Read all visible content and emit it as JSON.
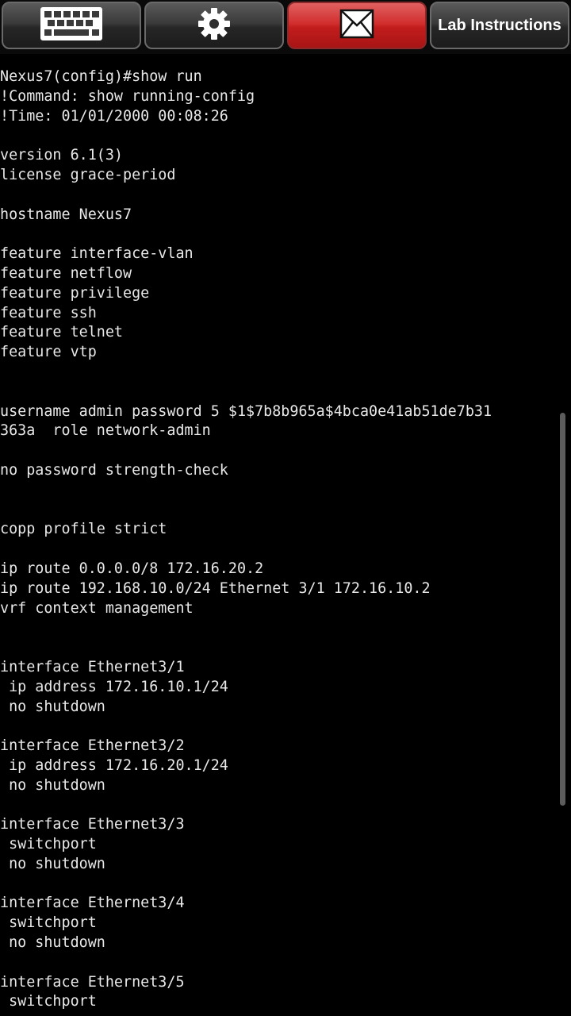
{
  "toolbar": {
    "keyboard_icon": "keyboard-icon",
    "settings_icon": "gear-icon",
    "mail_icon": "envelope-icon",
    "lab_instructions_label": "Lab Instructions",
    "colors": {
      "button_gray": "#3a3a3a",
      "button_red": "#d22f2f",
      "text": "#ffffff"
    }
  },
  "terminal": {
    "background": "#000000",
    "text_color": "#e8e8e8",
    "lines": [
      "Nexus7(config)#show run",
      "!Command: show running-config",
      "!Time: 01/01/2000 00:08:26",
      "",
      "version 6.1(3)",
      "license grace-period",
      "",
      "hostname Nexus7",
      "",
      "feature interface-vlan",
      "feature netflow",
      "feature privilege",
      "feature ssh",
      "feature telnet",
      "feature vtp",
      "",
      "",
      "username admin password 5 $1$7b8b965a$4bca0e41ab51de7b31",
      "363a  role network-admin",
      "",
      "no password strength-check",
      "",
      "",
      "copp profile strict",
      "",
      "ip route 0.0.0.0/8 172.16.20.2",
      "ip route 192.168.10.0/24 Ethernet 3/1 172.16.10.2",
      "vrf context management",
      "",
      "",
      "interface Ethernet3/1",
      " ip address 172.16.10.1/24",
      " no shutdown",
      "",
      "interface Ethernet3/2",
      " ip address 172.16.20.1/24",
      " no shutdown",
      "",
      "interface Ethernet3/3",
      " switchport",
      " no shutdown",
      "",
      "interface Ethernet3/4",
      " switchport",
      " no shutdown",
      "",
      "interface Ethernet3/5",
      " switchport"
    ]
  }
}
